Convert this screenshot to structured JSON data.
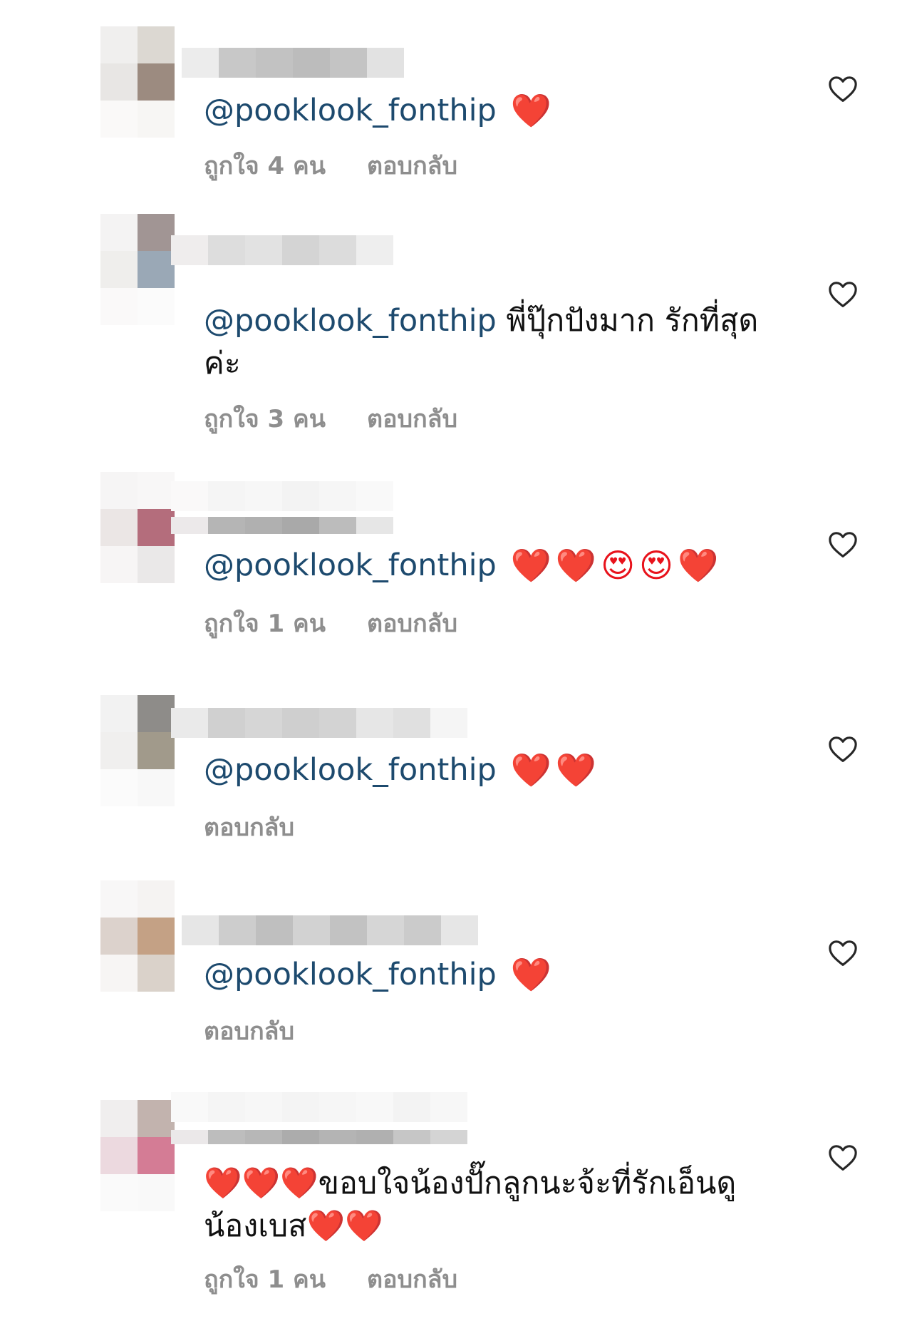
{
  "comments": [
    {
      "mention": "@pooklook_fonthip",
      "text": "",
      "emojis": "❤️",
      "likes_label": "ถูกใจ 4 คน",
      "reply_label": "ตอบกลับ"
    },
    {
      "mention": "@pooklook_fonthip",
      "text": "พี่ปุ๊กปังมาก รักที่สุดค่ะ",
      "emojis": "",
      "likes_label": "ถูกใจ 3 คน",
      "reply_label": "ตอบกลับ"
    },
    {
      "mention": "@pooklook_fonthip",
      "text": "",
      "emojis": "❤️❤️😍😍❤️",
      "likes_label": "ถูกใจ 1 คน",
      "reply_label": "ตอบกลับ"
    },
    {
      "mention": "@pooklook_fonthip",
      "text": "",
      "emojis": "❤️❤️",
      "likes_label": "",
      "reply_label": "ตอบกลับ"
    },
    {
      "mention": "@pooklook_fonthip",
      "text": "",
      "emojis": "❤️",
      "likes_label": "",
      "reply_label": "ตอบกลับ"
    },
    {
      "mention": "",
      "text": "❤️❤️❤️ขอบใจน้องปั๊กลูกนะจ้ะที่รักเอ็นดูน้องเบส❤️❤️",
      "emojis": "",
      "likes_label": "ถูกใจ 1 คน",
      "reply_label": "ตอบกลับ"
    }
  ],
  "icons": {
    "like": "heart-outline-icon"
  },
  "colors": {
    "mention": "#1d4a6e",
    "meta": "#8e8e8e",
    "heart": "#e8121b",
    "like_icon": "#262626"
  }
}
